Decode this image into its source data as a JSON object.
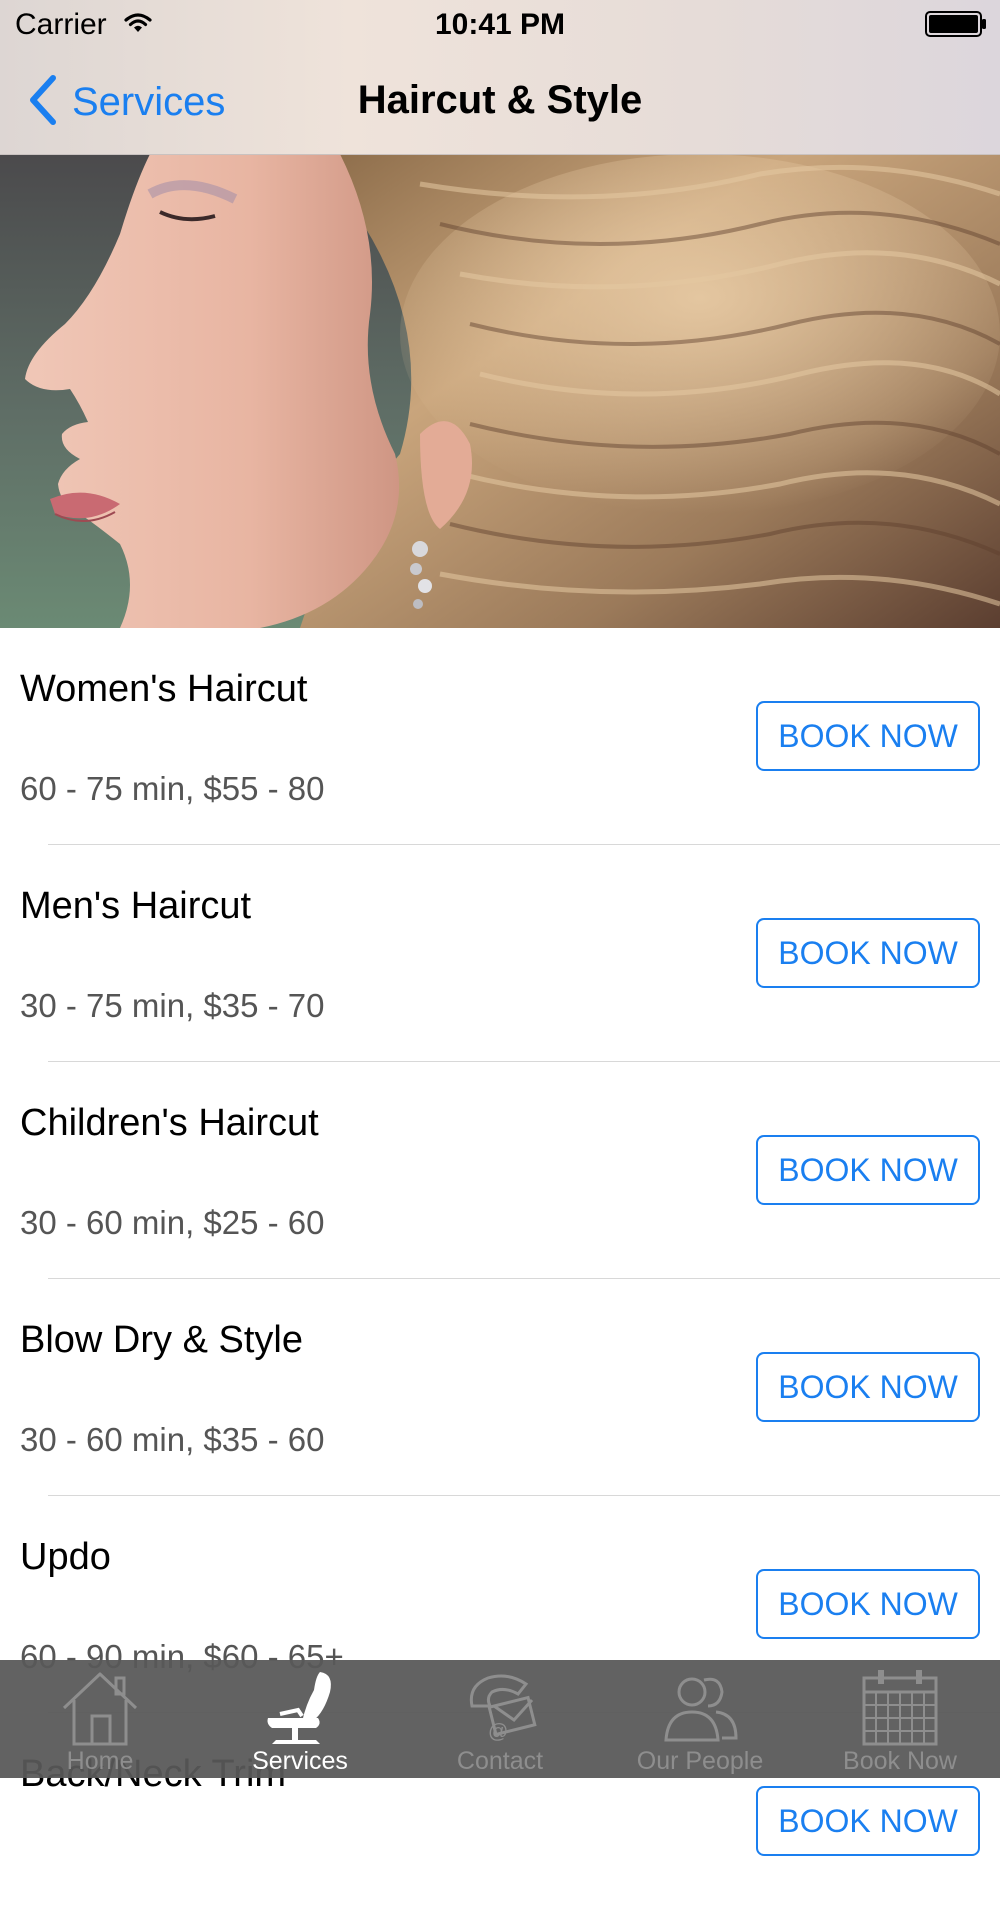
{
  "status_bar": {
    "carrier": "Carrier",
    "time": "10:41 PM"
  },
  "nav": {
    "back_label": "Services",
    "title": "Haircut & Style"
  },
  "services": [
    {
      "name": "Women's Haircut",
      "meta": "60 - 75 min, $55 - 80",
      "button": "BOOK NOW"
    },
    {
      "name": "Men's Haircut",
      "meta": "30 - 75 min, $35 - 70",
      "button": "BOOK NOW"
    },
    {
      "name": "Children's Haircut",
      "meta": "30 - 60 min, $25 - 60",
      "button": "BOOK NOW"
    },
    {
      "name": "Blow Dry & Style",
      "meta": "30 - 60 min, $35 - 60",
      "button": "BOOK NOW"
    },
    {
      "name": "Updo",
      "meta": "60 - 90 min, $60 - 65+",
      "button": "BOOK NOW"
    },
    {
      "name": "Back/Neck Trim",
      "meta": "",
      "button": "BOOK NOW"
    }
  ],
  "tabs": [
    {
      "label": "Home",
      "icon": "home-icon",
      "active": false
    },
    {
      "label": "Services",
      "icon": "salon-chair-icon",
      "active": true
    },
    {
      "label": "Contact",
      "icon": "phone-mail-icon",
      "active": false
    },
    {
      "label": "Our People",
      "icon": "people-icon",
      "active": false
    },
    {
      "label": "Book Now",
      "icon": "calendar-icon",
      "active": false
    }
  ],
  "colors": {
    "accent": "#1a7ff0",
    "tabbar": "#585858",
    "tab_inactive": "#8e8e8e",
    "tab_active": "#ffffff"
  }
}
